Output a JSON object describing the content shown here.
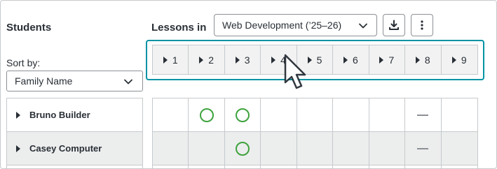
{
  "header": {
    "students_title": "Students",
    "lessons_title": "Lessons in",
    "course_select_value": "Web Development (’25–26)"
  },
  "icons": {
    "download": "download-icon",
    "more": "more-vertical-icon",
    "chevron": "chevron-down-icon",
    "expand": "caret-right-icon",
    "cursor": "mouse-pointer-icon"
  },
  "sort": {
    "label": "Sort by:",
    "value": "Family Name"
  },
  "lessons": [
    "1",
    "2",
    "3",
    "4",
    "5",
    "6",
    "7",
    "8",
    "9"
  ],
  "students": [
    {
      "name": "Bruno Builder",
      "progress": [
        "empty",
        "complete",
        "complete",
        "empty",
        "empty",
        "empty",
        "empty",
        "not-applicable",
        "empty"
      ]
    },
    {
      "name": "Casey Computer",
      "progress": [
        "empty",
        "empty",
        "complete",
        "empty",
        "empty",
        "empty",
        "empty",
        "not-applicable",
        "empty"
      ]
    }
  ],
  "colors": {
    "highlight": "#0093a4",
    "complete": "#3ea33e",
    "border": "#c6cacd",
    "text": "#292f36"
  }
}
